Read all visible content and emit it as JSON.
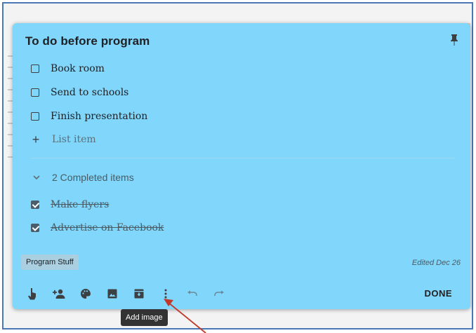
{
  "note": {
    "title": "To do before program",
    "items": [
      {
        "label": "Book room",
        "checked": false
      },
      {
        "label": "Send to schools",
        "checked": false
      },
      {
        "label": "Finish presentation",
        "checked": false
      }
    ],
    "add_item_placeholder": "List item",
    "completed_toggle_label": "2 Completed items",
    "completed_items": [
      {
        "label": "Make flyers",
        "checked": true
      },
      {
        "label": "Advertise on Facebook",
        "checked": true
      }
    ],
    "label_chip": "Program Stuff",
    "edited": "Edited Dec 26"
  },
  "toolbar": {
    "icons": [
      "reminder-icon",
      "collaborator-icon",
      "palette-icon",
      "add-image-icon",
      "archive-icon",
      "more-icon",
      "undo-icon",
      "redo-icon"
    ],
    "done_label": "DONE"
  },
  "tooltip": {
    "text": "Add image"
  },
  "colors": {
    "note_background": "#80d6fb",
    "tooltip_background": "#333333",
    "annotation_arrow": "#c0392b"
  }
}
